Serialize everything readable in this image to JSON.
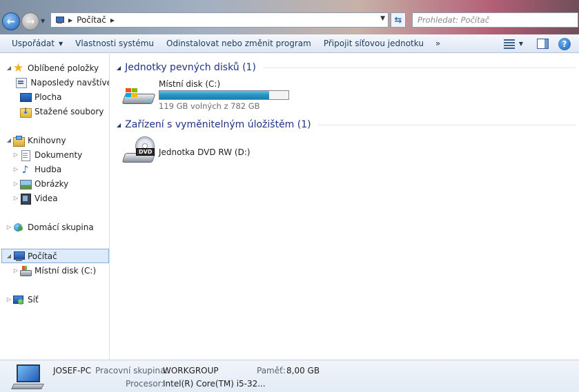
{
  "address": {
    "crumb": "Počítač",
    "search_placeholder": "Prohledat: Počítač"
  },
  "toolbar": {
    "organize": "Uspořádat",
    "system_properties": "Vlastnosti systému",
    "uninstall": "Odinstalovat nebo změnit program",
    "map_drive": "Připojit síťovou jednotku",
    "overflow": "»"
  },
  "nav": {
    "favorites": {
      "label": "Oblíbené položky",
      "items": [
        "Naposledy navštívené",
        "Plocha",
        "Stažené soubory"
      ]
    },
    "libraries": {
      "label": "Knihovny",
      "items": [
        "Dokumenty",
        "Hudba",
        "Obrázky",
        "Videa"
      ]
    },
    "homegroup": "Domácí skupina",
    "computer": {
      "label": "Počítač",
      "items": [
        "Místní disk (C:)"
      ]
    },
    "network": "Síť"
  },
  "content": {
    "groups": [
      {
        "title": "Jednotky pevných disků (1)",
        "drives": [
          {
            "name": "Místní disk (C:)",
            "free_text": "119 GB volných z 782 GB",
            "used_fraction": 0.848
          }
        ]
      },
      {
        "title": "Zařízení s vyměnitelným úložištěm (1)",
        "drives": [
          {
            "name": "Jednotka DVD RW (D:)",
            "badge": "DVD"
          }
        ]
      }
    ]
  },
  "details": {
    "computer_name": "JOSEF-PC",
    "workgroup_label": "Pracovní skupina:",
    "workgroup_value": "WORKGROUP",
    "memory_label": "Paměť:",
    "memory_value": "8,00 GB",
    "processor_label": "Procesor:",
    "processor_value": "Intel(R) Core(TM) i5-32..."
  },
  "icons": {
    "back": "back-arrow-icon",
    "forward": "forward-arrow-icon",
    "refresh": "refresh-icon",
    "help": "help-icon",
    "views": "change-view-icon",
    "preview_pane": "preview-pane-icon"
  },
  "colors": {
    "group_title": "#1e3287",
    "capacity_bar": "#2a96c4",
    "selection": "#dceaf9"
  }
}
